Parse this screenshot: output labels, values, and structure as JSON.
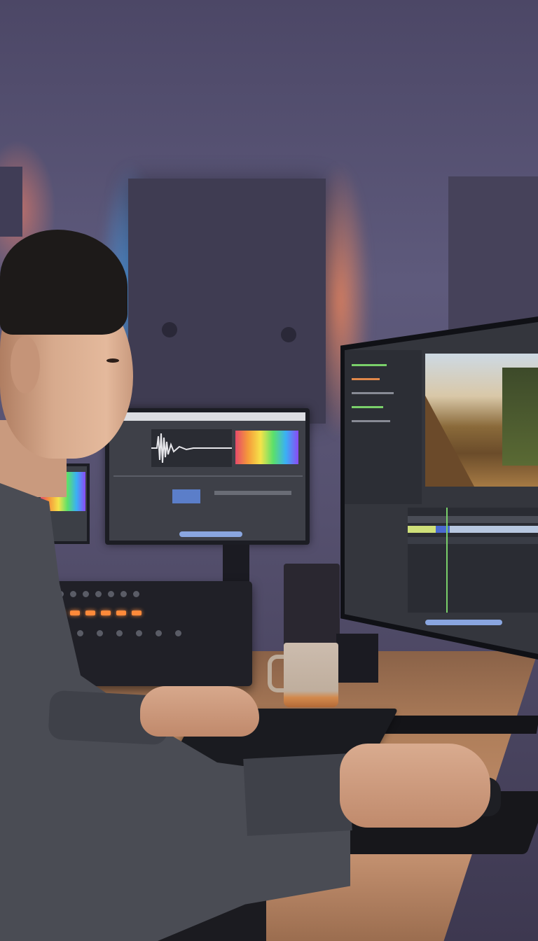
{
  "scene": {
    "colors": {
      "wall": "#55506e",
      "glow_blue": "#46aaff",
      "glow_orange": "#ff8c5a",
      "desk": "#b07f5b",
      "sweater": "#4a4c54"
    },
    "icons": [
      "editing-monitor-icon",
      "audio-waveform-icon",
      "mixer-console-icon",
      "keyboard-icon",
      "mouse-icon",
      "mug-icon"
    ]
  }
}
